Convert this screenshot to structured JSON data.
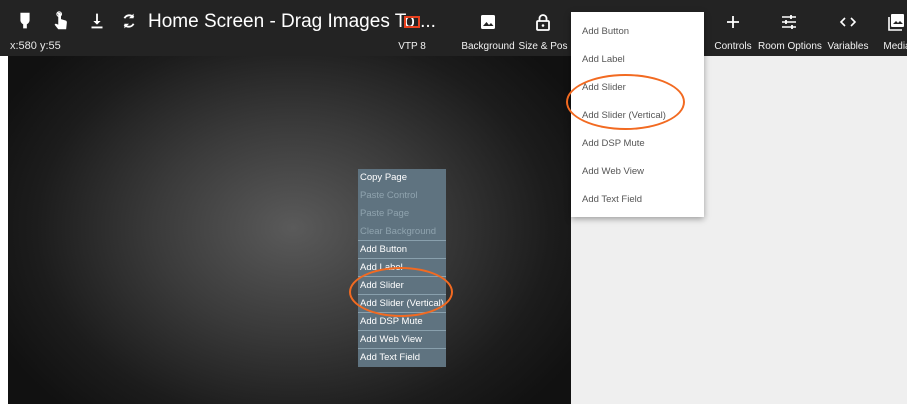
{
  "toolbar": {
    "title": "Home Screen - Drag Images To ...",
    "coordinates": "x:580 y:55",
    "buttons": [
      {
        "label": "VTP 8",
        "icon": "device-icon"
      },
      {
        "label": "Background",
        "icon": "image-icon"
      },
      {
        "label": "Size & Pos",
        "icon": "lock-icon"
      },
      {
        "label": "Controls",
        "icon": "plus-icon"
      },
      {
        "label": "Room Options",
        "icon": "sliders-icon"
      },
      {
        "label": "Variables",
        "icon": "code-icon"
      },
      {
        "label": "Media",
        "icon": "media-icon"
      }
    ],
    "accent_color": "#e8411f"
  },
  "context_menu": {
    "items": [
      {
        "label": "Copy Page",
        "enabled": true
      },
      {
        "label": "Paste Control",
        "enabled": false
      },
      {
        "label": "Paste Page",
        "enabled": false
      },
      {
        "label": "Clear Background",
        "enabled": false
      },
      {
        "label": "Add Button",
        "enabled": true
      },
      {
        "label": "Add Label",
        "enabled": true
      },
      {
        "label": "Add Slider",
        "enabled": true
      },
      {
        "label": "Add Slider (Vertical)",
        "enabled": true
      },
      {
        "label": "Add DSP Mute",
        "enabled": true
      },
      {
        "label": "Add Web View",
        "enabled": true
      },
      {
        "label": "Add Text Field",
        "enabled": true
      }
    ]
  },
  "controls_dropdown": {
    "items": [
      "Add Button",
      "Add Label",
      "Add Slider",
      "Add Slider (Vertical)",
      "Add DSP Mute",
      "Add Web View",
      "Add Text Field"
    ]
  },
  "highlight_color": "#f26a21"
}
